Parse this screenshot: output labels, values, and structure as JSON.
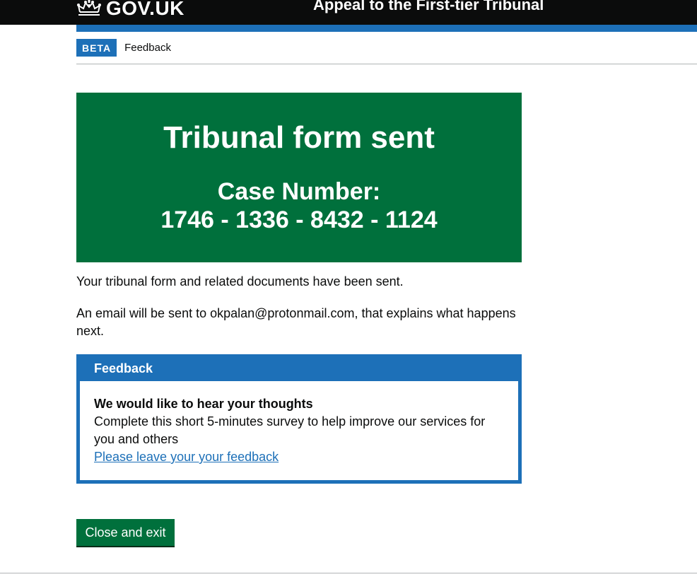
{
  "header": {
    "logo_icon": "crown-icon",
    "logo_text": "GOV.UK",
    "service_name": "Appeal to the First-tier Tribunal",
    "colors": {
      "background": "#0b0c0c",
      "accent_bar": "#1d70b8"
    }
  },
  "phase_banner": {
    "tag": "BETA",
    "text": "Feedback"
  },
  "confirmation": {
    "title": "Tribunal form sent",
    "case_label": "Case Number:",
    "case_number": "1746 - 1336 - 8432 - 1124",
    "color": "#00703c"
  },
  "body": {
    "sent_text": "Your tribunal form and related documents have been sent.",
    "email_text": "An email will be sent to okpalan@protonmail.com, that explains what happens next."
  },
  "feedback": {
    "title": "Feedback",
    "heading": "We would like to hear your thoughts",
    "description": "Complete this short 5-minutes survey to help improve our services for you and others",
    "link_text": "Please leave your your feedback",
    "color": "#1d70b8"
  },
  "actions": {
    "close_label": "Close and exit"
  }
}
